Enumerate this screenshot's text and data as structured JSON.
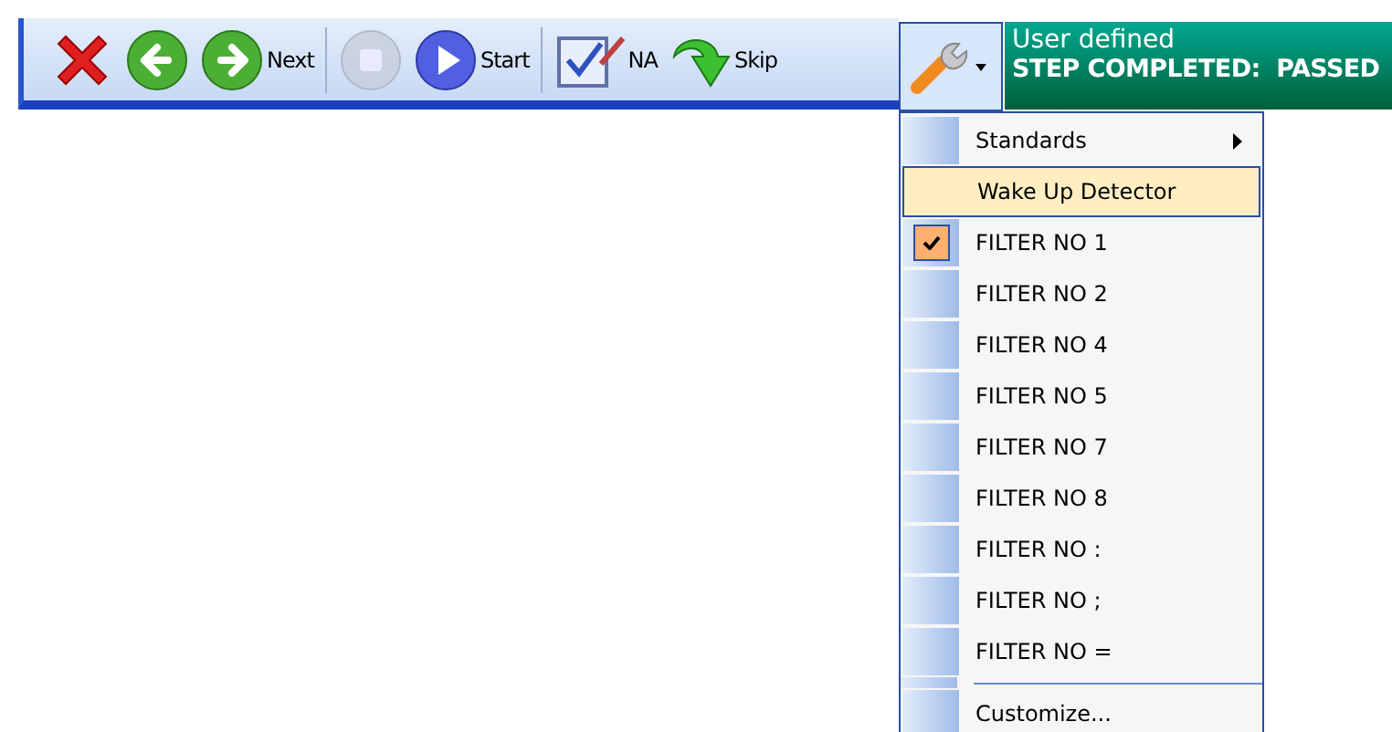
{
  "toolbar": {
    "buttons": [
      {
        "kind": "close",
        "disabled": false
      },
      {
        "kind": "back",
        "disabled": false
      },
      {
        "kind": "next",
        "label": "Next",
        "disabled": false
      },
      {
        "kind": "stop",
        "disabled": true
      },
      {
        "kind": "start",
        "label": "Start",
        "disabled": false
      },
      {
        "kind": "na",
        "label": "NA",
        "disabled": false
      },
      {
        "kind": "skip",
        "label": "Skip",
        "disabled": false
      }
    ],
    "tools_button": {
      "expanded": true
    }
  },
  "status": {
    "title": "User defined",
    "message": "STEP COMPLETED:  PASSED"
  },
  "menu": {
    "items": [
      {
        "kind": "submenu",
        "label": "Standards",
        "selected": false,
        "checked": false
      },
      {
        "kind": "item",
        "label": "Wake Up Detector",
        "selected": true,
        "checked": false
      },
      {
        "kind": "item",
        "label": "FILTER NO 1",
        "selected": false,
        "checked": true
      },
      {
        "kind": "item",
        "label": "FILTER NO 2",
        "selected": false,
        "checked": false
      },
      {
        "kind": "item",
        "label": "FILTER NO 4",
        "selected": false,
        "checked": false
      },
      {
        "kind": "item",
        "label": "FILTER NO 5",
        "selected": false,
        "checked": false
      },
      {
        "kind": "item",
        "label": "FILTER NO 7",
        "selected": false,
        "checked": false
      },
      {
        "kind": "item",
        "label": "FILTER NO 8",
        "selected": false,
        "checked": false
      },
      {
        "kind": "item",
        "label": "FILTER NO :",
        "selected": false,
        "checked": false
      },
      {
        "kind": "item",
        "label": "FILTER NO ;",
        "selected": false,
        "checked": false
      },
      {
        "kind": "item",
        "label": "FILTER NO =",
        "selected": false,
        "checked": false
      },
      {
        "kind": "separator"
      },
      {
        "kind": "item",
        "label": "Customize...",
        "selected": false,
        "checked": false
      }
    ]
  }
}
